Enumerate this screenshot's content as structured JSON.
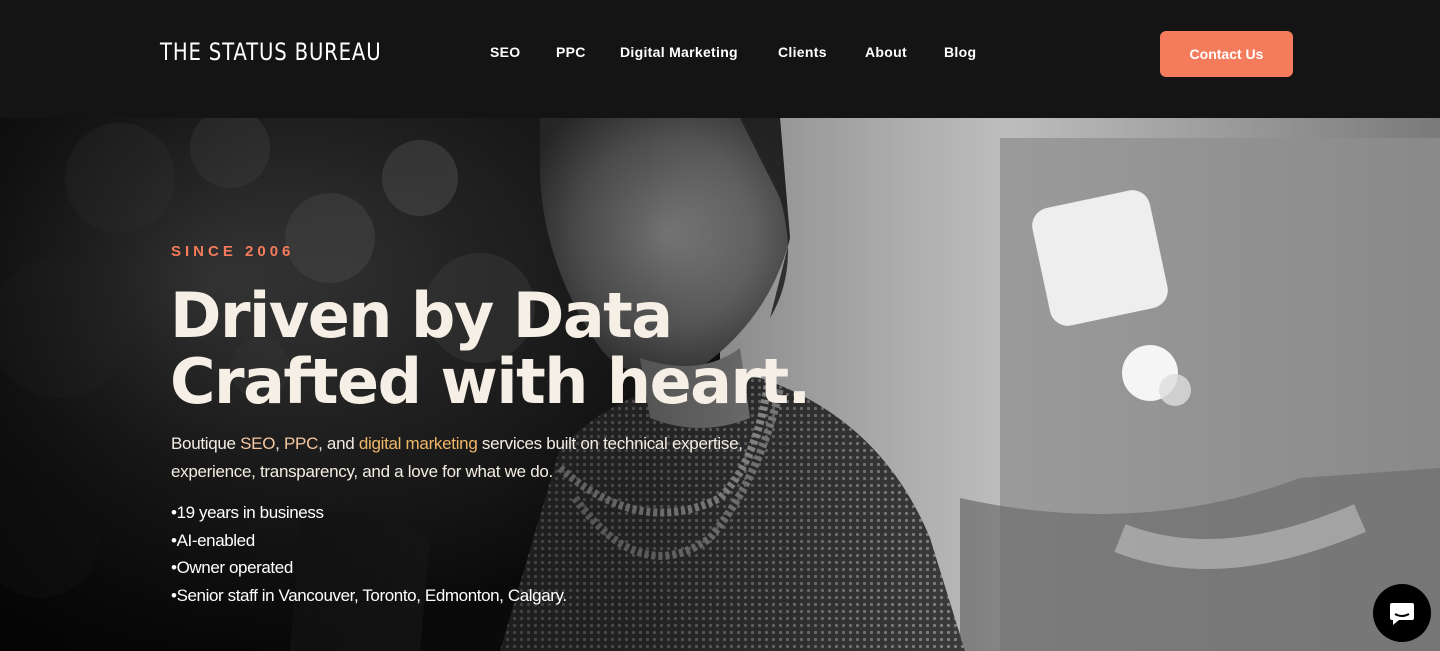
{
  "header": {
    "logo_text": "THE STATUS BUREAU",
    "nav": [
      "SEO",
      "PPC",
      "Digital Marketing",
      "Clients",
      "About",
      "Blog"
    ],
    "contact_label": "Contact Us"
  },
  "hero": {
    "eyebrow": "SINCE 2006",
    "headline_line1": "Driven by Data",
    "headline_line2": "Crafted with heart.",
    "intro": {
      "prefix": "Boutique ",
      "seo": "SEO",
      "comma1": ", ",
      "ppc": "PPC",
      "and": ", and ",
      "digital_marketing": "digital marketing",
      "suffix": " services built on technical expertise, experience, transparency, and a love for what we do."
    },
    "bullets": [
      "19 years in business",
      "AI-enabled",
      "Owner operated",
      "Senior staff in Vancouver, Toronto, Edmonton, Calgary."
    ]
  },
  "colors": {
    "accent": "#f47c5c",
    "header_bg": "#141414",
    "headline": "#f6efe6",
    "link_gold": "#f0b768"
  },
  "icons": {
    "chat": "chat-bubble-icon",
    "photo": "hero-photo"
  }
}
